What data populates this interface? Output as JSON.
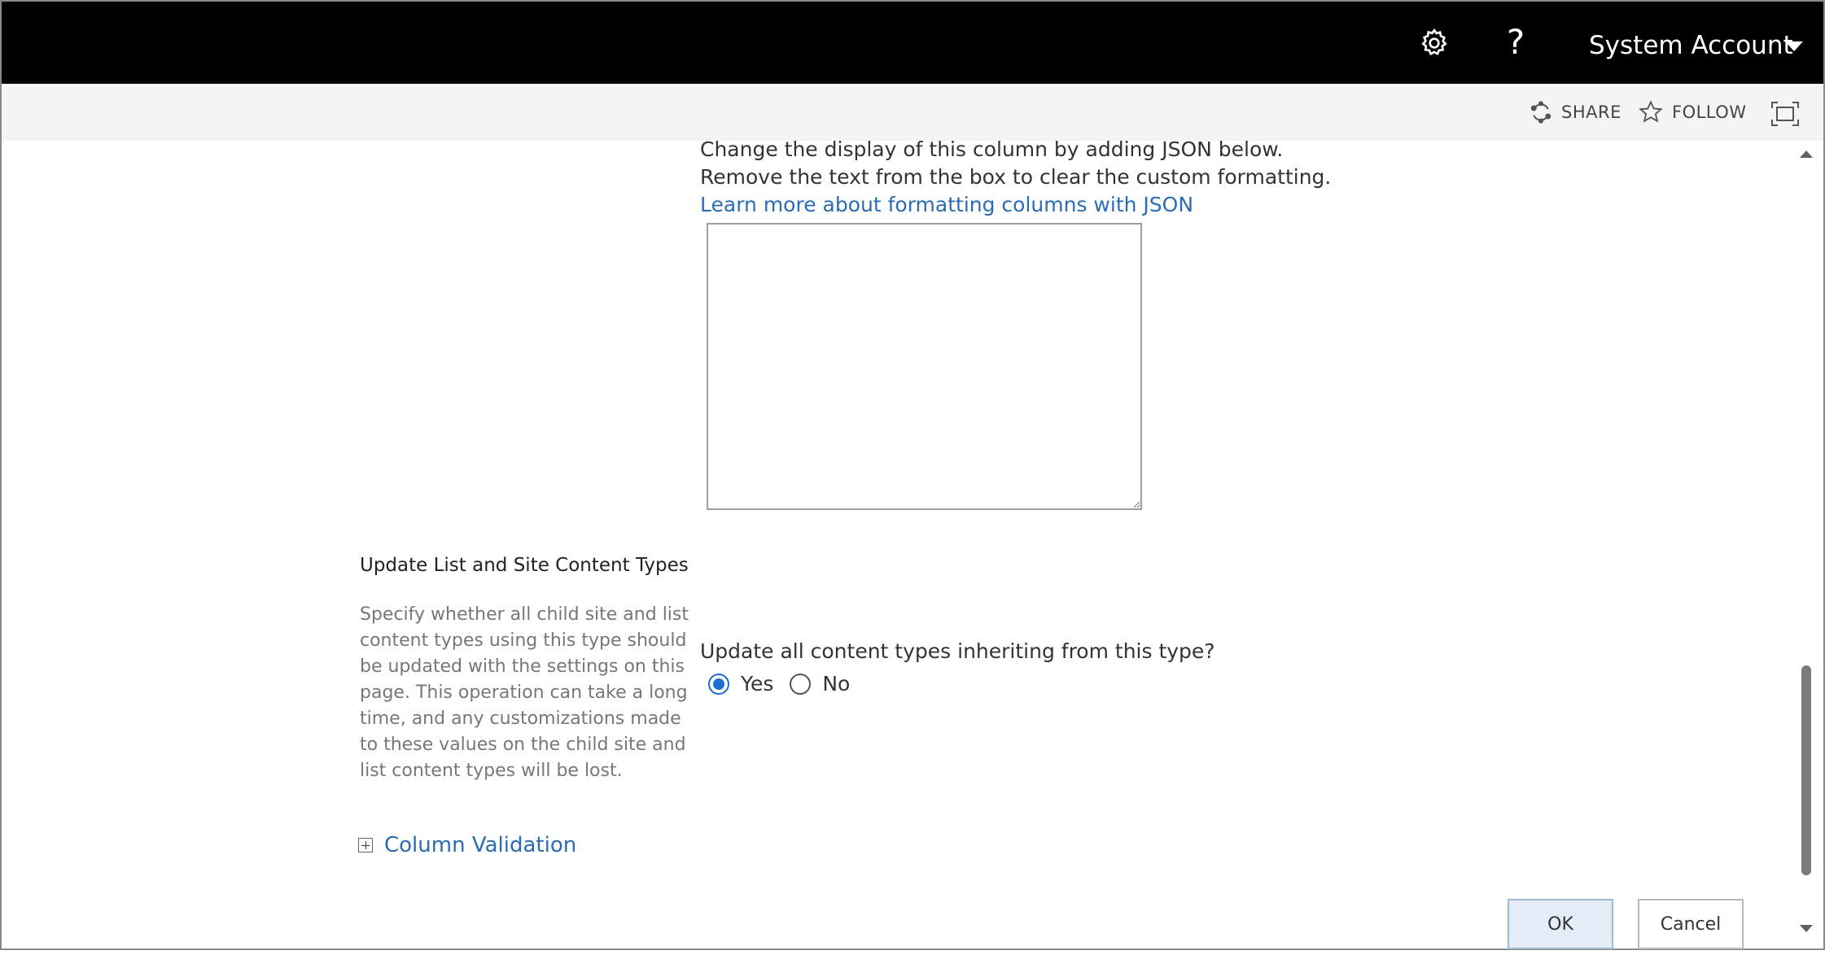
{
  "suite_bar": {
    "account_name": "System Account",
    "help_symbol": "?",
    "icons": {
      "settings": "gear-icon",
      "account_menu": "chevron-down-icon"
    }
  },
  "action_bar": {
    "share_label": "SHARE",
    "follow_label": "FOLLOW",
    "icons": {
      "share": "share-icon",
      "follow": "star-icon",
      "focus": "focus-mode-icon"
    }
  },
  "formatting": {
    "line1": "Change the display of this column by adding JSON below.",
    "line2": "Remove the text from the box to clear the custom formatting.",
    "learn_more_link": "Learn more about formatting columns with JSON",
    "json_value": ""
  },
  "update_section": {
    "title": "Update List and Site Content Types",
    "description": "Specify whether all child site and list content types using this type should be updated with the settings on this page. This operation can take a long time, and any customizations made to these values on the child site and list content types will be lost.",
    "question": "Update all content types inheriting from this type?",
    "options": [
      {
        "label": "Yes",
        "selected": true
      },
      {
        "label": "No",
        "selected": false
      }
    ]
  },
  "column_validation": {
    "label": "Column Validation",
    "icon": "expand-plus-icon"
  },
  "buttons": {
    "ok": "OK",
    "cancel": "Cancel"
  },
  "colors": {
    "accent": "#2a6cb5",
    "radio_selected": "#1e6fd0",
    "suite_bar": "#000000"
  }
}
